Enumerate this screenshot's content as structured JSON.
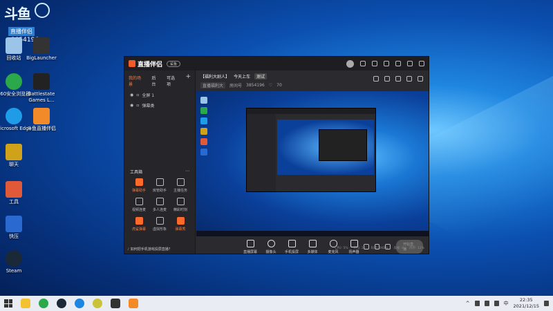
{
  "desktop": {
    "top_badge": {
      "logo": "斗鱼",
      "sub": "直播伴侣",
      "number": "3854196",
      "suffix": "插"
    },
    "icons": [
      {
        "label": "回收站",
        "color": "#9cc4e8"
      },
      {
        "label": "BigLauncher",
        "color": "#333333"
      },
      {
        "label": "360安全浏览器",
        "color": "#2aa84a"
      },
      {
        "label": "Battlestate Games L...",
        "color": "#222222"
      },
      {
        "label": "Microsoft Edge",
        "color": "#1f9ce8"
      },
      {
        "label": "斗鱼直播伴侣",
        "color": "#f28a2a"
      },
      {
        "label": "聊天",
        "color": "#d0a21a"
      },
      {
        "label": "工具",
        "color": "#e05a3a"
      },
      {
        "label": "快压",
        "color": "#2a6ad0"
      },
      {
        "label": "Steam",
        "color": "#1b2838"
      }
    ]
  },
  "app": {
    "title": "直播伴侣",
    "version_badge": "鲨鱼",
    "left_tabs": [
      "我的场景",
      "后台",
      "可选项"
    ],
    "scenes": [
      "全屏 1",
      "弹幕类"
    ],
    "tools_title": "工具箱",
    "tools": [
      {
        "label": "弹幕助手",
        "hot": true
      },
      {
        "label": "房管助手",
        "hot": false
      },
      {
        "label": "主播任务",
        "hot": false
      },
      {
        "label": "视频连麦",
        "hot": false
      },
      {
        "label": "多人连麦",
        "hot": false
      },
      {
        "label": "精彩时刻",
        "hot": false
      },
      {
        "label": "虎鲨弹幕",
        "hot": true
      },
      {
        "label": "虚拟形象",
        "hot": false
      },
      {
        "label": "弹幕秀",
        "hot": true
      }
    ],
    "notice": "如何把手机游戏投屏直播？",
    "room": {
      "title": "【福利大剧人】",
      "subtitle": "今天上车",
      "tag": "测试",
      "category_edit": "直播福利大",
      "room_label": "房间号",
      "room_id": "3854196",
      "followers": "70"
    },
    "controls": [
      "直播屏幕",
      "摄像头",
      "手机投屏",
      "多媒体",
      "麦克风",
      "扬声器"
    ],
    "live_button": "开始直播",
    "status": [
      "CPU: 5%",
      "FPS: 30",
      "码率: 0KB/s",
      "丢帧: 0",
      "内存: 12%"
    ]
  },
  "taskbar": {
    "apps": [
      {
        "name": "file-explorer",
        "color": "#f2c230"
      },
      {
        "name": "360-browser",
        "color": "#2aa84a"
      },
      {
        "name": "steam",
        "color": "#1b2838"
      },
      {
        "name": "douyu",
        "color": "#1f86e0"
      },
      {
        "name": "battlestate",
        "color": "#333333"
      },
      {
        "name": "streamer-assistant",
        "color": "#f28a2a"
      }
    ],
    "ime": "中",
    "time": "22:35",
    "date": "2021/12/15"
  }
}
